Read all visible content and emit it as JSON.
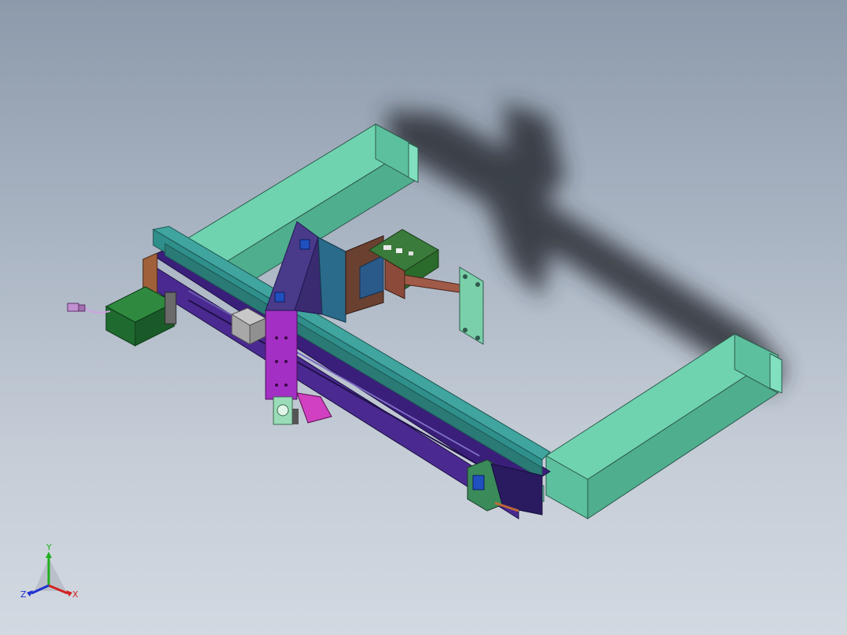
{
  "viewport": {
    "background_top": "#8d9aab",
    "background_bottom": "#d3d9e1"
  },
  "colors": {
    "frame_mint": "#6fd3b0",
    "frame_mint_dark": "#4fae8e",
    "beam_teal": "#2f8f8a",
    "rail_purple": "#3a1f7a",
    "carriage_magenta": "#a32fc4",
    "plate_brown": "#8b4a3a",
    "motor_green": "#1f6b2f",
    "board_green": "#3a7a3a",
    "shadow": "#2a2e35"
  },
  "triad": {
    "x_label": "X",
    "y_label": "Y",
    "z_label": "Z",
    "x_color": "#d22020",
    "y_color": "#20b020",
    "z_color": "#2030d0"
  },
  "icons": {
    "orientation_triad": "xyz-axis-triad-icon"
  }
}
